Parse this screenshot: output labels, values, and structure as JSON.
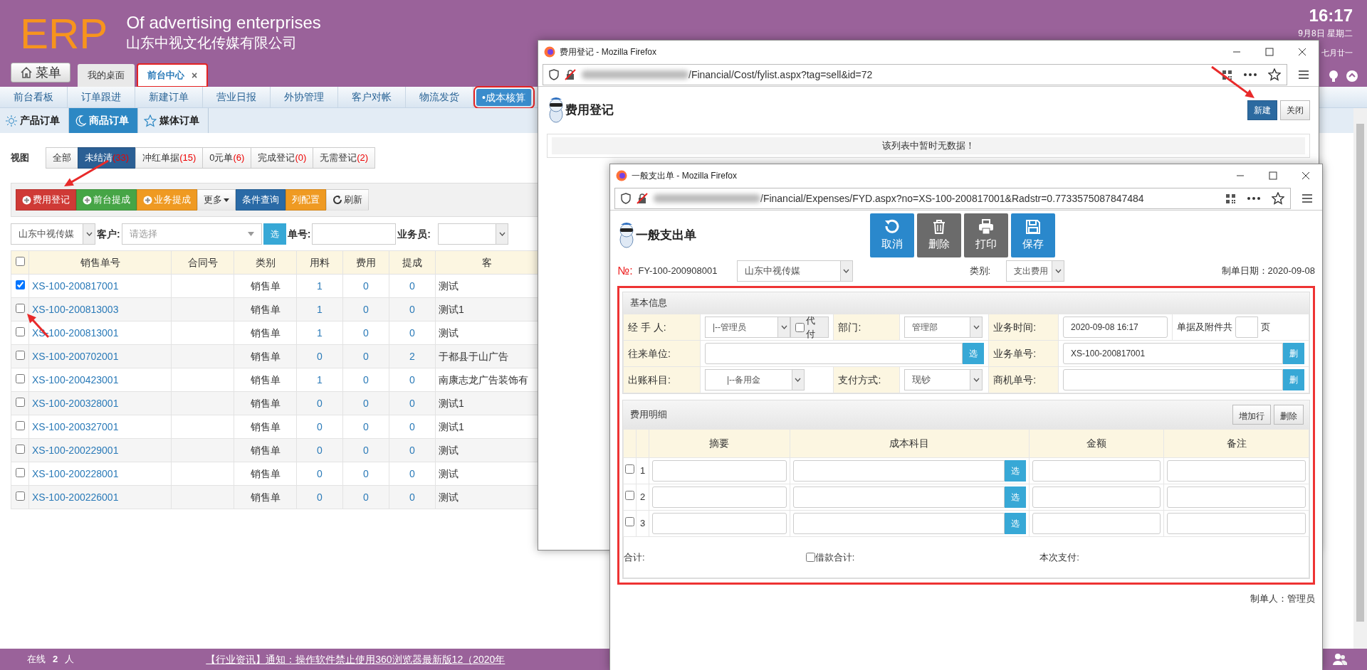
{
  "header": {
    "logo": "ERP",
    "tagline": "Of advertising enterprises",
    "company": "山东中视文化传媒有限公司",
    "menu_button": "菜单",
    "clock": "16:17",
    "date": "9月8日 星期二",
    "lunar": "七月廿一"
  },
  "tabs": [
    {
      "label": "我的桌面",
      "selected": false
    },
    {
      "label": "前台中心",
      "selected": true,
      "close": "×"
    }
  ],
  "nav": [
    {
      "label": "前台看板",
      "selected": false
    },
    {
      "label": "订单跟进",
      "selected": false
    },
    {
      "label": "新建订单",
      "selected": false
    },
    {
      "label": "营业日报",
      "selected": false
    },
    {
      "label": "外协管理",
      "selected": false
    },
    {
      "label": "客户对帐",
      "selected": false
    },
    {
      "label": "物流发货",
      "selected": false
    },
    {
      "label": "•成本核算",
      "selected": true
    }
  ],
  "subtabs": [
    {
      "label": "产品订单",
      "selected": false
    },
    {
      "label": "商品订单",
      "selected": true
    },
    {
      "label": "媒体订单",
      "selected": false
    }
  ],
  "view": {
    "label": "视图",
    "filters": [
      {
        "label": "全部",
        "selected": false
      },
      {
        "label": "未结清",
        "count": "(33)",
        "selected": true
      },
      {
        "label": "冲红单据",
        "count": "(15)",
        "selected": false
      },
      {
        "label": "0元单",
        "count": "(6)",
        "selected": false
      },
      {
        "label": "完成登记",
        "count": "(0)",
        "selected": false
      },
      {
        "label": "无需登记",
        "count": "(2)",
        "selected": false
      }
    ]
  },
  "toolbar": [
    {
      "label": "费用登记",
      "kind": "add"
    },
    {
      "label": "前台提成",
      "kind": "add"
    },
    {
      "label": "业务提成",
      "kind": "add"
    },
    {
      "label": "更多",
      "kind": "dropdown"
    },
    {
      "label": "条件查询",
      "kind": "plain"
    },
    {
      "label": "列配置",
      "kind": "plain"
    },
    {
      "label": "刷新",
      "kind": "refresh"
    }
  ],
  "filters": {
    "company": "山东中视传媒",
    "customer_label": "客户:",
    "customer_placeholder": "请选择",
    "pick_button": "选",
    "order_label": "单号:",
    "salesman_label": "业务员:"
  },
  "table": {
    "select_all": false,
    "columns": [
      "销售单号",
      "合同号",
      "类别",
      "用料",
      "费用",
      "提成",
      "客"
    ],
    "rows": [
      {
        "checked": true,
        "order_no": "XS-100-200817001",
        "type": "销售单",
        "material": "1",
        "fee": "0",
        "commission": "0",
        "customer": "测试"
      },
      {
        "checked": false,
        "order_no": "XS-100-200813003",
        "type": "销售单",
        "material": "1",
        "fee": "0",
        "commission": "0",
        "customer": "测试1"
      },
      {
        "checked": false,
        "order_no": "XS-100-200813001",
        "type": "销售单",
        "material": "1",
        "fee": "0",
        "commission": "0",
        "customer": "测试"
      },
      {
        "checked": false,
        "order_no": "XS-100-200702001",
        "type": "销售单",
        "material": "0",
        "fee": "0",
        "commission": "2",
        "customer": "于都县于山广告"
      },
      {
        "checked": false,
        "order_no": "XS-100-200423001",
        "type": "销售单",
        "material": "1",
        "fee": "0",
        "commission": "0",
        "customer": "南康志龙广告装饰有"
      },
      {
        "checked": false,
        "order_no": "XS-100-200328001",
        "type": "销售单",
        "material": "0",
        "fee": "0",
        "commission": "0",
        "customer": "测试1"
      },
      {
        "checked": false,
        "order_no": "XS-100-200327001",
        "type": "销售单",
        "material": "0",
        "fee": "0",
        "commission": "0",
        "customer": "测试1"
      },
      {
        "checked": false,
        "order_no": "XS-100-200229001",
        "type": "销售单",
        "material": "0",
        "fee": "0",
        "commission": "0",
        "customer": "测试"
      },
      {
        "checked": false,
        "order_no": "XS-100-200228001",
        "type": "销售单",
        "material": "0",
        "fee": "0",
        "commission": "0",
        "customer": "测试"
      },
      {
        "checked": false,
        "order_no": "XS-100-200226001",
        "type": "销售单",
        "material": "0",
        "fee": "0",
        "commission": "0",
        "customer": "测试"
      }
    ]
  },
  "status_bar": {
    "online_label": "在线",
    "online_count": "2",
    "online_unit": "人",
    "notice": "【行业资讯】通知：操作软件禁止使用360浏览器最新版12（2020年"
  },
  "cost_window": {
    "title": "费用登记 - Mozilla Firefox",
    "url": "/Financial/Cost/fylist.aspx?tag=sell&id=72",
    "page_title": "费用登记",
    "buttons": [
      "新建",
      "关闭"
    ],
    "empty_message": "该列表中暂时无数据！"
  },
  "expense_window": {
    "title": "一般支出单 - Mozilla Firefox",
    "url": "/Financial/Expenses/FYD.aspx?no=XS-100-200817001&Radstr=0.7733575087847484",
    "page_title": "一般支出单",
    "actions": [
      {
        "label": "取消",
        "kind": "undo"
      },
      {
        "label": "删除",
        "kind": "trash"
      },
      {
        "label": "打印",
        "kind": "print"
      },
      {
        "label": "保存",
        "kind": "save"
      }
    ],
    "number_label": "№:",
    "number": "FY-100-200908001",
    "company": "山东中视传媒",
    "category_label": "类别:",
    "category": "支出费用",
    "date": "制单日期：2020-09-08",
    "basic": {
      "title": "基本信息",
      "handler_label": "经 手 人:",
      "handler": "|--管理员",
      "proxy_label": "代付",
      "proxy_checked": false,
      "dept_label": "部门:",
      "dept": "管理部",
      "time_label": "业务时间:",
      "time": "2020-09-08 16:17",
      "attach_label": "单据及附件共",
      "attach_unit": "页",
      "partner_label": "往来单位:",
      "partner_pick": "选",
      "biz_no_label": "业务单号:",
      "biz_no": "XS-100-200817001",
      "biz_no_delete": "删",
      "account_label": "出账科目:",
      "account": "|--备用金",
      "pay_label": "支付方式:",
      "pay": "现钞",
      "opp_label": "商机单号:",
      "opp_delete": "删"
    },
    "details": {
      "title": "费用明细",
      "buttons": [
        "增加行",
        "删除"
      ],
      "columns": [
        "摘要",
        "成本科目",
        "金额",
        "备注"
      ],
      "rows": [
        {
          "number": "1",
          "checked": false,
          "pick": "选"
        },
        {
          "number": "2",
          "checked": false,
          "pick": "选"
        },
        {
          "number": "3",
          "checked": false,
          "pick": "选"
        }
      ],
      "total_label": "合计:",
      "loan_label": "借款合计:",
      "loan_checked": false,
      "payment_label": "本次支付:"
    },
    "maker": "制单人：管理员"
  }
}
